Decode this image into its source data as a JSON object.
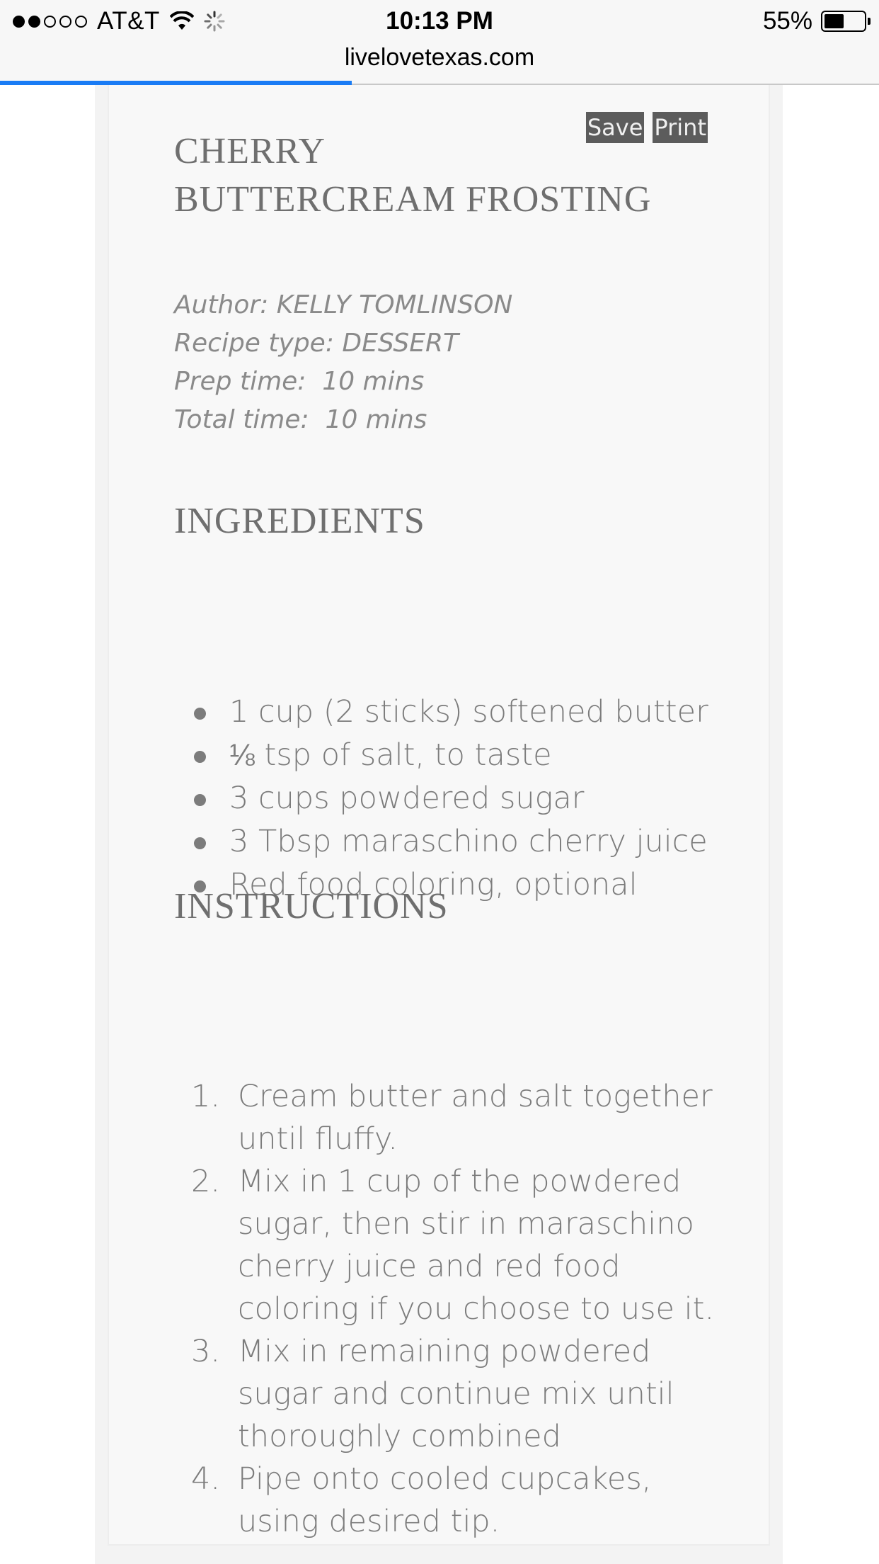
{
  "status_bar": {
    "carrier": "AT&T",
    "time": "10:13 PM",
    "battery_percent": "55%",
    "battery_level": 0.55,
    "signal_bars": 2,
    "signal_total": 5
  },
  "browser": {
    "url": "livelovetexas.com",
    "load_progress": 0.4
  },
  "recipe": {
    "save_label": "Save",
    "print_label": "Print",
    "title_line1": "CHERRY",
    "title_line2": "BUTTERCREAM FROSTING",
    "author": "Author: KELLY TOMLINSON",
    "recipe_type": "Recipe type: DESSERT",
    "prep_time": "Prep time:  10 mins",
    "total_time": "Total time:  10 mins",
    "ingredients_heading": "INGREDIENTS",
    "ingredients": [
      "1 cup (2 sticks) softened butter",
      "⅛ tsp of salt, to taste",
      "3 cups powdered sugar",
      "3 Tbsp maraschino cherry juice",
      "Red food coloring, optional"
    ],
    "instructions_heading": "INSTRUCTIONS",
    "instructions": [
      "Cream butter and salt together until fluffy.",
      "Mix in 1 cup of the powdered sugar, then stir in maraschino cherry juice and red food coloring if you choose to use it.",
      "Mix in remaining powdered sugar and continue mix until thoroughly combined",
      "Pipe onto cooled cupcakes, using desired tip."
    ]
  },
  "colors": {
    "progress_blue": "#1a7cf5",
    "button_bg": "#5c5c5c",
    "heading_gray": "#6f6f6f",
    "body_gray": "#7c7c7c"
  }
}
